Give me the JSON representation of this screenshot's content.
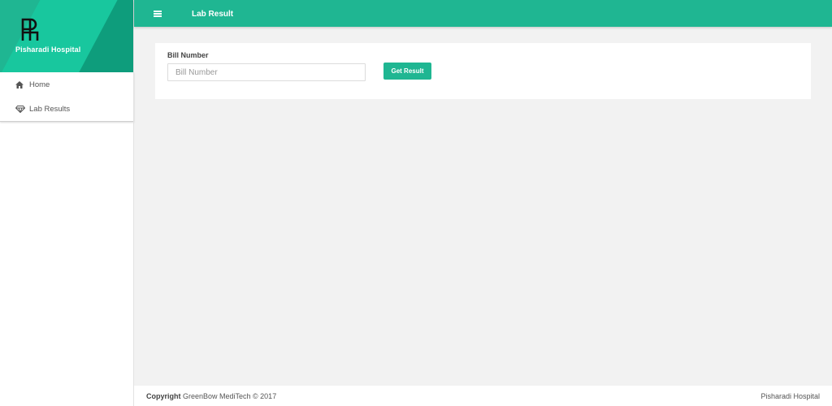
{
  "brand": {
    "name": "Pisharadi Hospital"
  },
  "sidebar": {
    "items": [
      {
        "label": "Home",
        "icon": "home-icon"
      },
      {
        "label": "Lab Results",
        "icon": "diamond-icon"
      }
    ]
  },
  "header": {
    "title": "Lab Result",
    "menu_icon": "hamburger-icon"
  },
  "form": {
    "field_label": "Bill Number",
    "input_placeholder": "Bill Number",
    "input_value": "",
    "button_label": "Get Result"
  },
  "footer": {
    "copyright_bold": "Copyright",
    "copyright_text": " GreenBow MediTech © 2017",
    "right_text": "Pisharadi Hospital"
  },
  "colors": {
    "accent": "#1fb692",
    "background": "#f2f2f2"
  }
}
